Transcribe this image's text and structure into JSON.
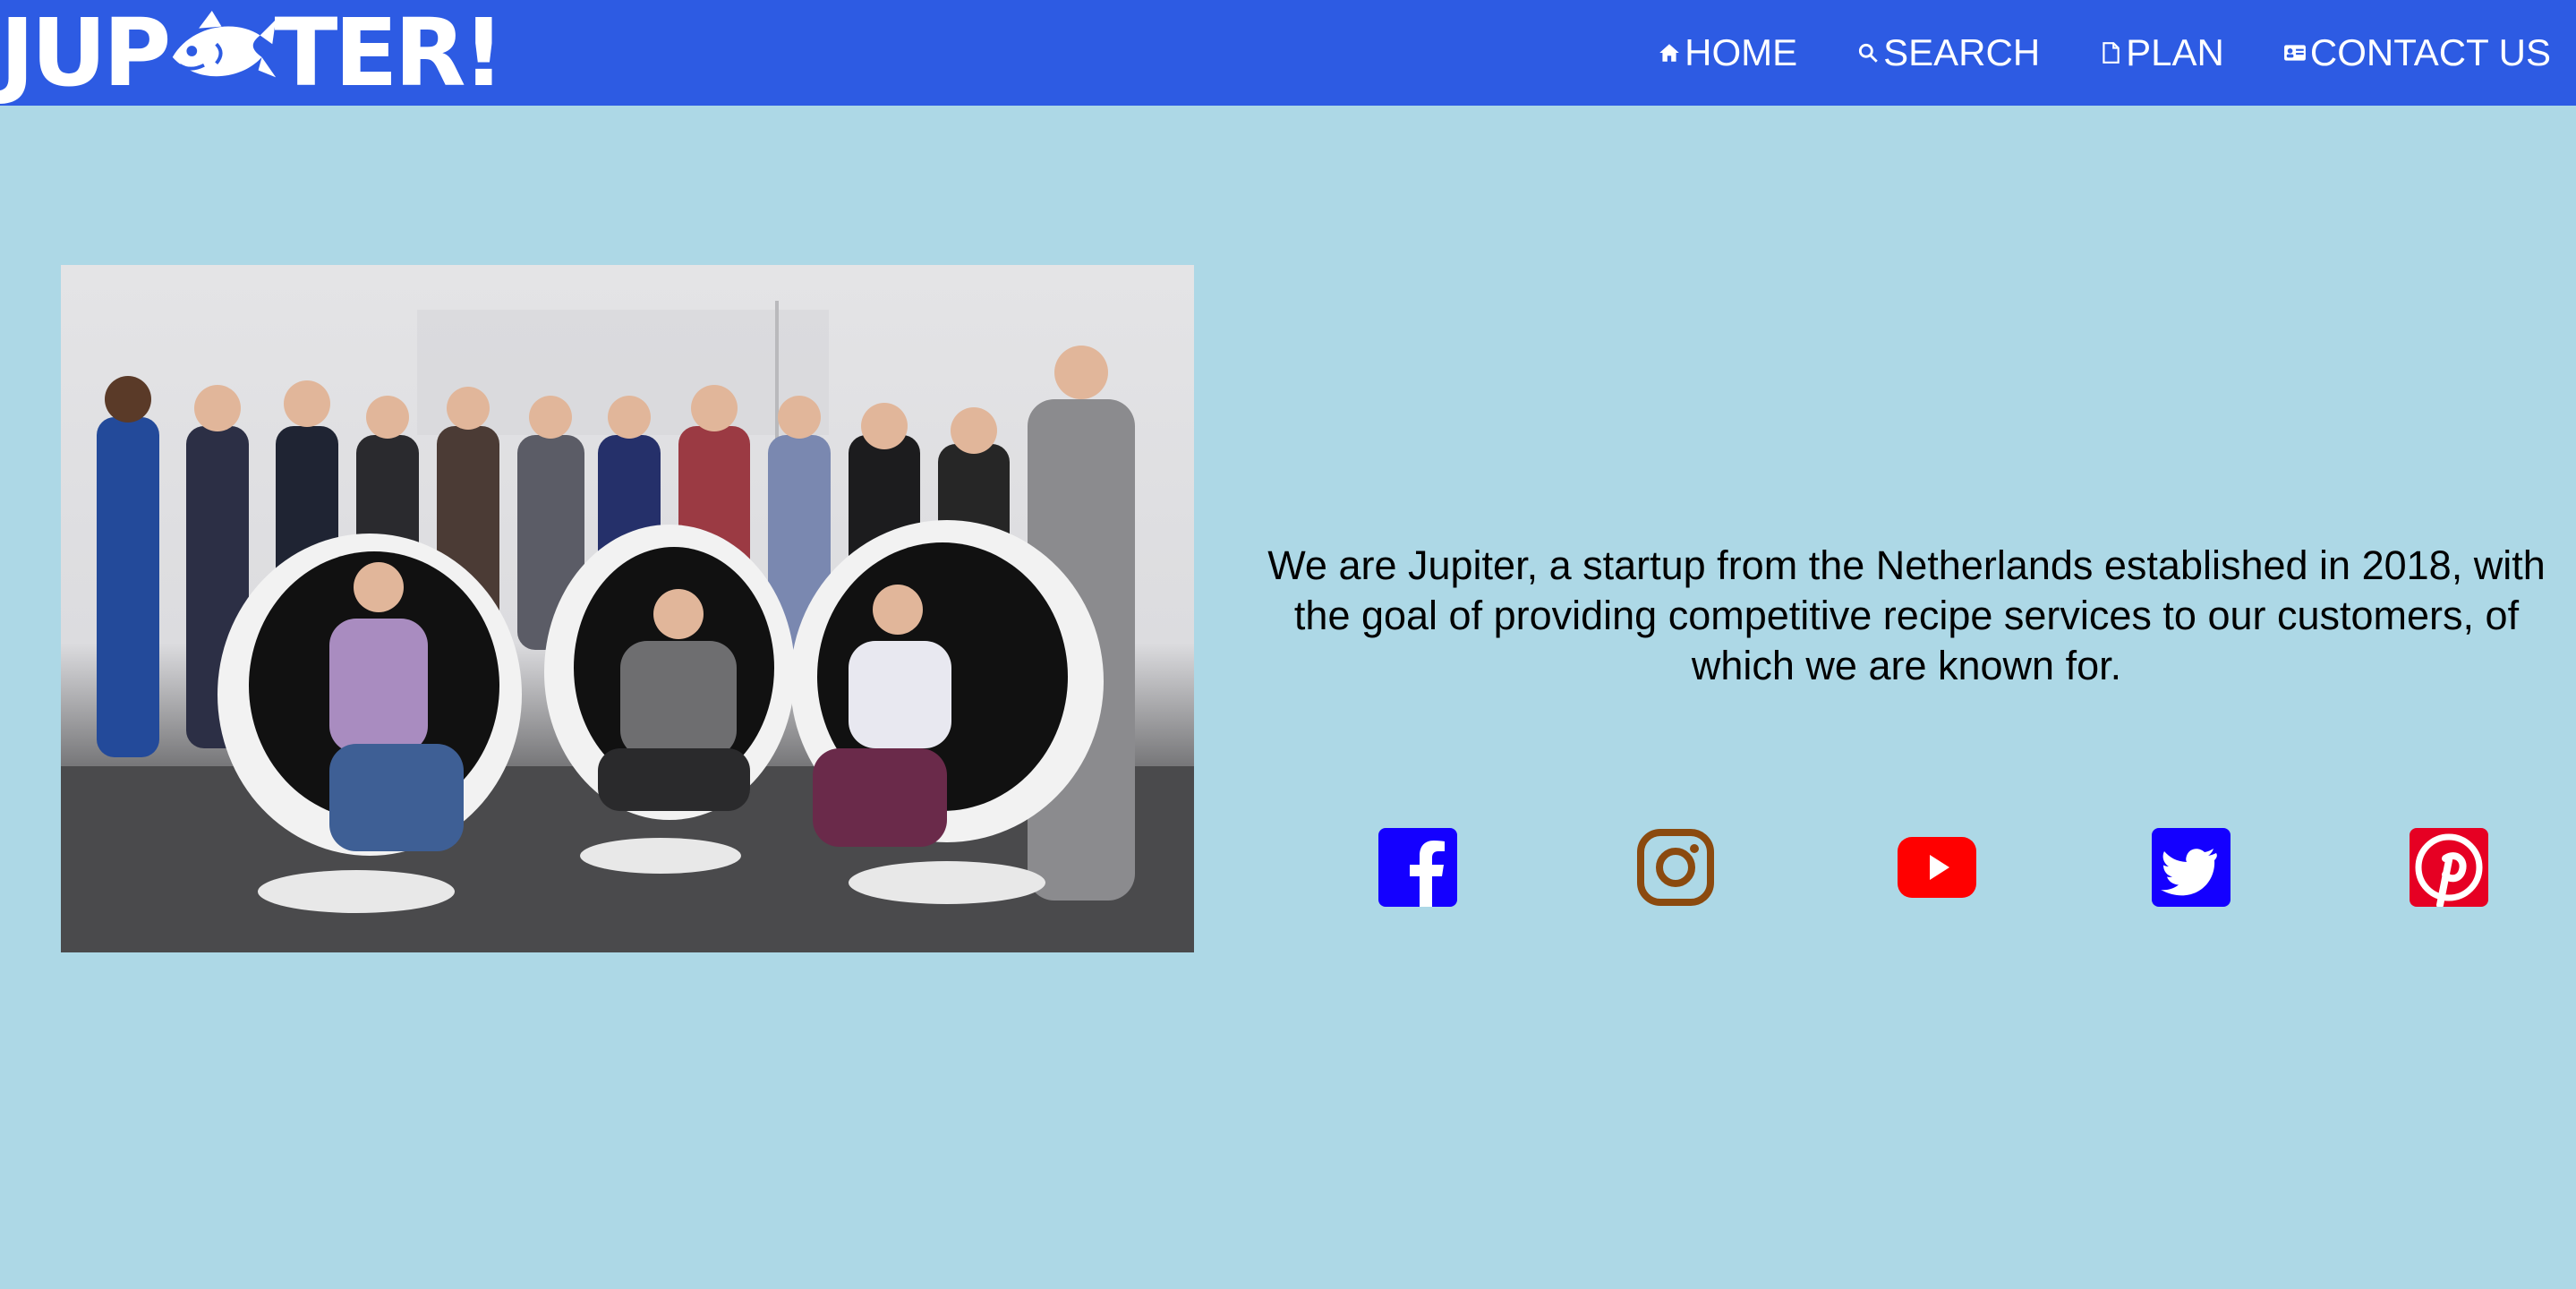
{
  "header": {
    "logo": {
      "part1": "JUP",
      "part2": "TER!",
      "mascot_icon": "fish-icon",
      "color": "#ffffff"
    },
    "background": "#2d5be3",
    "nav": [
      {
        "label": "HOME",
        "icon": "home-icon"
      },
      {
        "label": "SEARCH",
        "icon": "search-icon"
      },
      {
        "label": "PLAN",
        "icon": "document-icon"
      },
      {
        "label": "CONTACT US",
        "icon": "contact-card-icon"
      }
    ]
  },
  "main": {
    "background": "#add8e6",
    "team_photo": {
      "subject": "team-photo"
    },
    "about_text": "We are Jupiter, a startup from the Netherlands established in 2018, with the goal of providing competitive recipe services to our customers, of which we are known for."
  },
  "social": [
    {
      "name": "facebook-icon",
      "color": "#1400ff"
    },
    {
      "name": "instagram-icon",
      "color": "#8b4a0f"
    },
    {
      "name": "youtube-icon",
      "color": "#ff0000"
    },
    {
      "name": "twitter-icon",
      "color": "#1400ff"
    },
    {
      "name": "pinterest-icon",
      "color": "#e60023"
    }
  ]
}
